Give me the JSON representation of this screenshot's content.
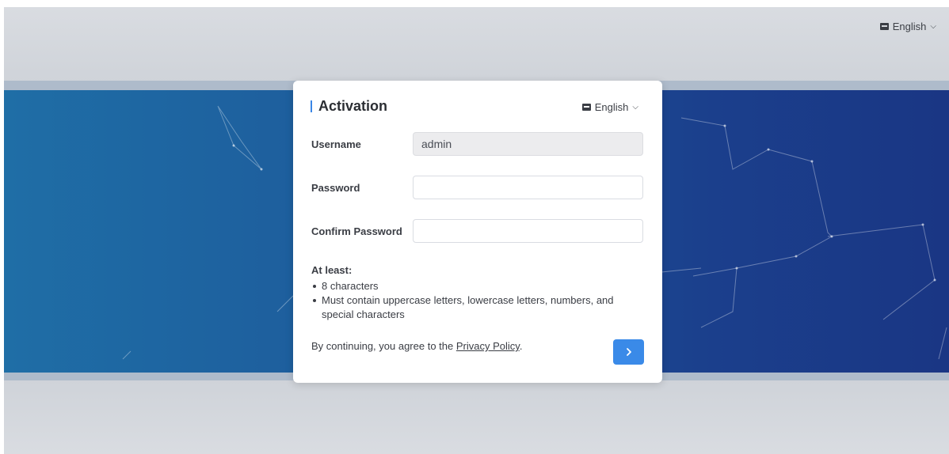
{
  "header": {
    "language": "English",
    "flag_icon": "language-flag-icon"
  },
  "dialog": {
    "title": "Activation",
    "language": "English",
    "fields": {
      "username": {
        "label": "Username",
        "value": "admin"
      },
      "password": {
        "label": "Password",
        "value": ""
      },
      "confirm_password": {
        "label": "Confirm Password",
        "value": ""
      }
    },
    "rules": {
      "heading": "At least:",
      "items": [
        "8 characters",
        "Must contain uppercase letters, lowercase letters, numbers, and special characters"
      ]
    },
    "agreement": {
      "prefix": "By continuing, you agree to the ",
      "link": "Privacy Policy",
      "suffix": "."
    },
    "next_button_icon": "chevron-right-icon"
  },
  "colors": {
    "accent": "#3a8ae8",
    "band_left": "#1f6ea6",
    "band_right": "#1a3684"
  }
}
